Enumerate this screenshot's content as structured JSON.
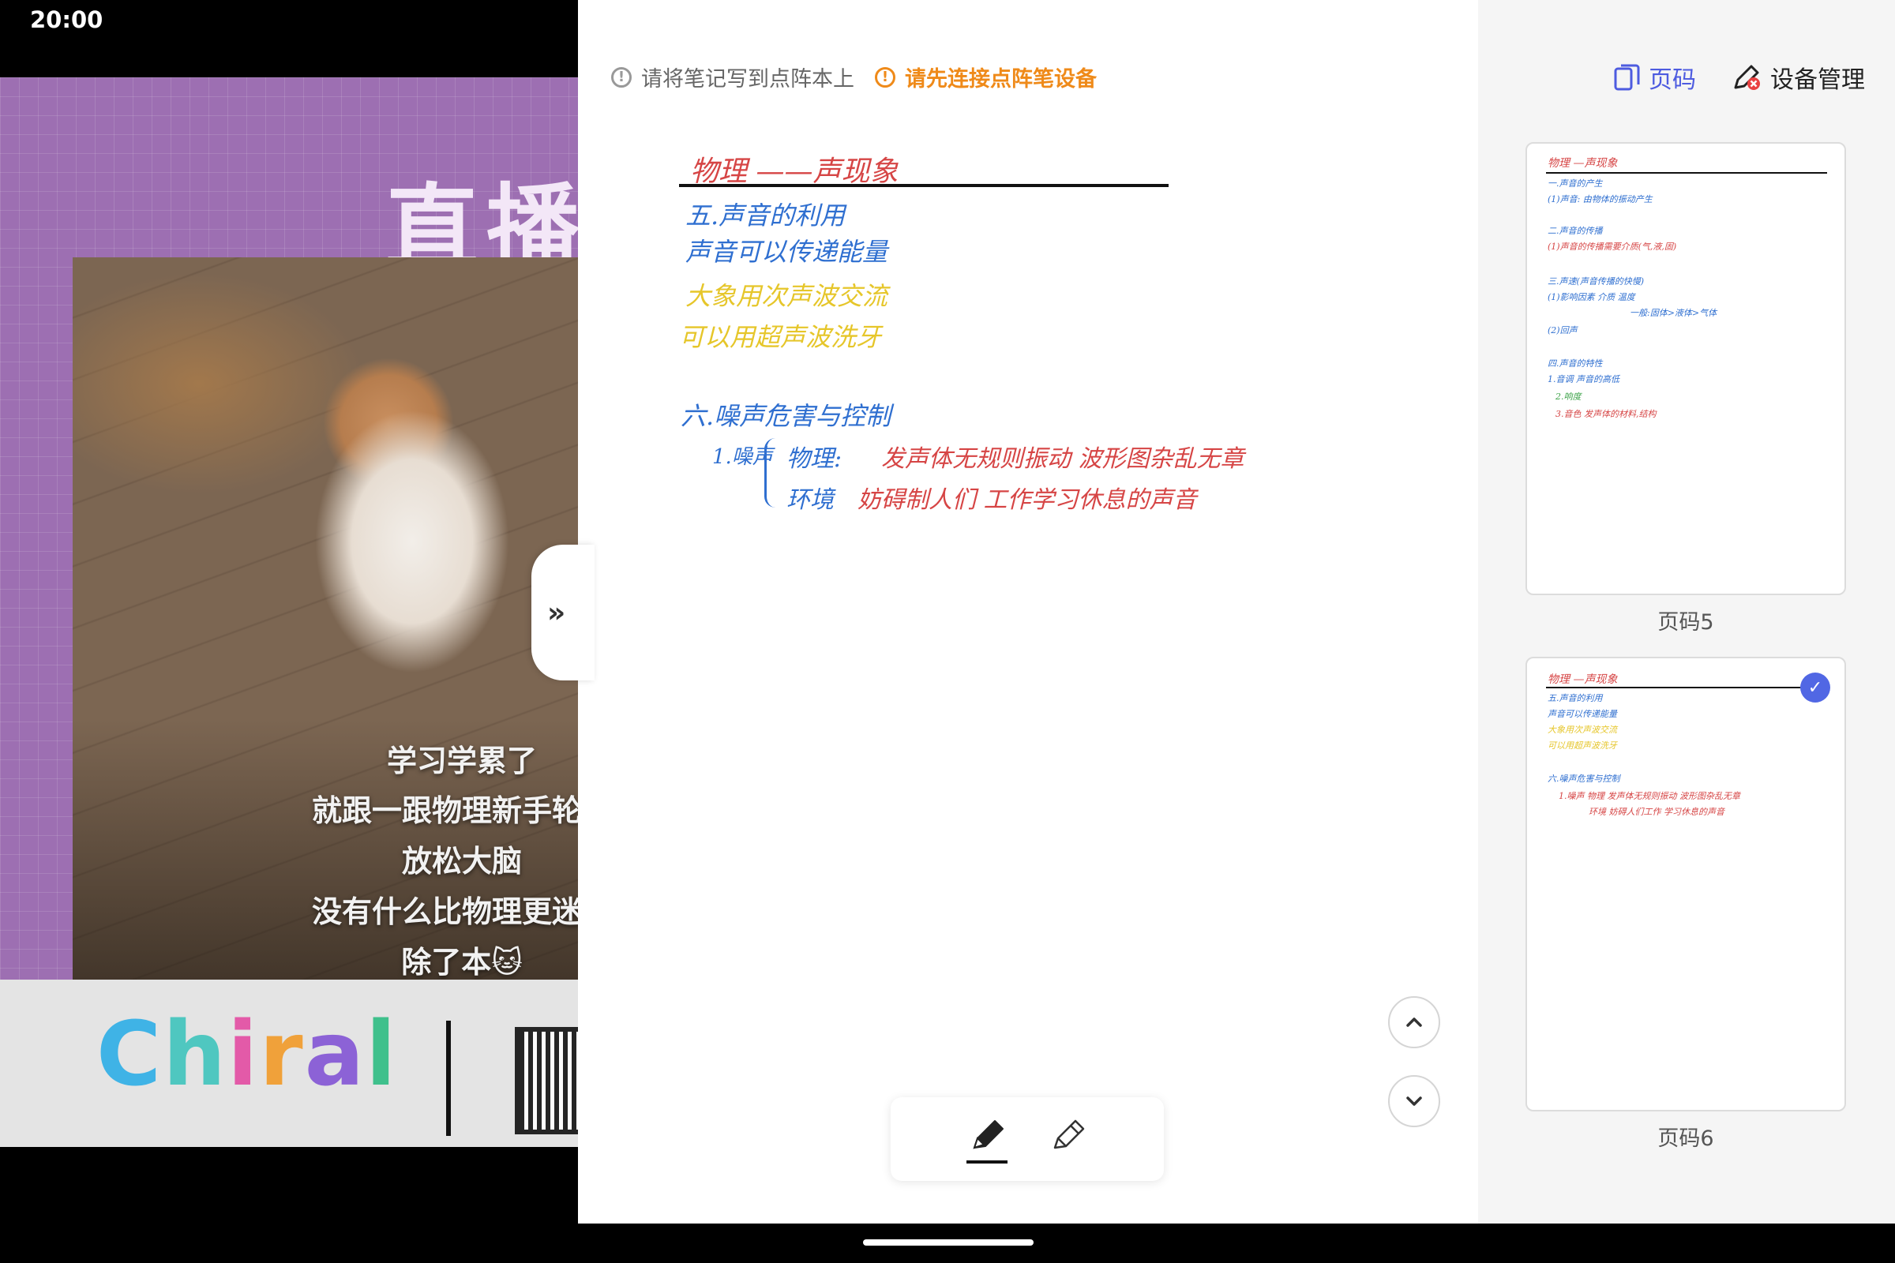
{
  "status_bar": {
    "time": "20:00"
  },
  "video": {
    "title": "直播",
    "captions": [
      "学习学累了",
      "就跟一跟物理新手轮直",
      "放松大脑",
      "没有什么比物理更迷人",
      "除了本🐱"
    ],
    "logo_text": "Chiral"
  },
  "note": {
    "hint_gray": "请将笔记写到点阵本上",
    "hint_orange": "请先连接点阵笔设备",
    "lines": {
      "title": "物理 ——声现象",
      "l1": "五.声音的利用",
      "l2": "声音可以传递能量",
      "l3": "大象用次声波交流",
      "l4": "可以用超声波洗牙",
      "l5": "六.噪声危害与控制",
      "l6": "1.噪声",
      "l7": "物理:",
      "l8": "发声体无规则振动 波形图杂乱无章",
      "l9": "环境",
      "l10": "妨碍制人们 工作学习休息的声音"
    }
  },
  "sidebar": {
    "page_label": "页码",
    "device_label": "设备管理",
    "thumbs": [
      {
        "label": "页码5",
        "lines": [
          "物理 —声现象",
          "一.声音的产生",
          "(1)声音: 由物体的振动产生",
          "二.声音的传播",
          "(1)声音的传播需要介质(气,液,固)",
          "三.声速(声音传播的快慢)",
          "(1)影响因素 介质 温度",
          "一般:固体>液体>气体",
          "(2)回声",
          "四.声音的特性",
          "1.音调 声音的高低",
          "2.响度",
          "3.音色 发声体的材料,结构"
        ]
      },
      {
        "label": "页码6",
        "lines": [
          "物理 —声现象",
          "五.声音的利用",
          "声音可以传递能量",
          "大象用次声波交流",
          "可以用超声波洗牙",
          "六.噪声危害与控制",
          "1.噪声 物理 发声体无规则振动 波形图杂乱无章",
          "环境 妨碍人们工作 学习休息的声音"
        ]
      }
    ]
  },
  "colors": {
    "accent": "#4d5be0",
    "warning": "#ef8a19",
    "ink_red": "#d64545",
    "ink_blue": "#2f6fd0",
    "ink_yellow": "#e6c62a"
  }
}
